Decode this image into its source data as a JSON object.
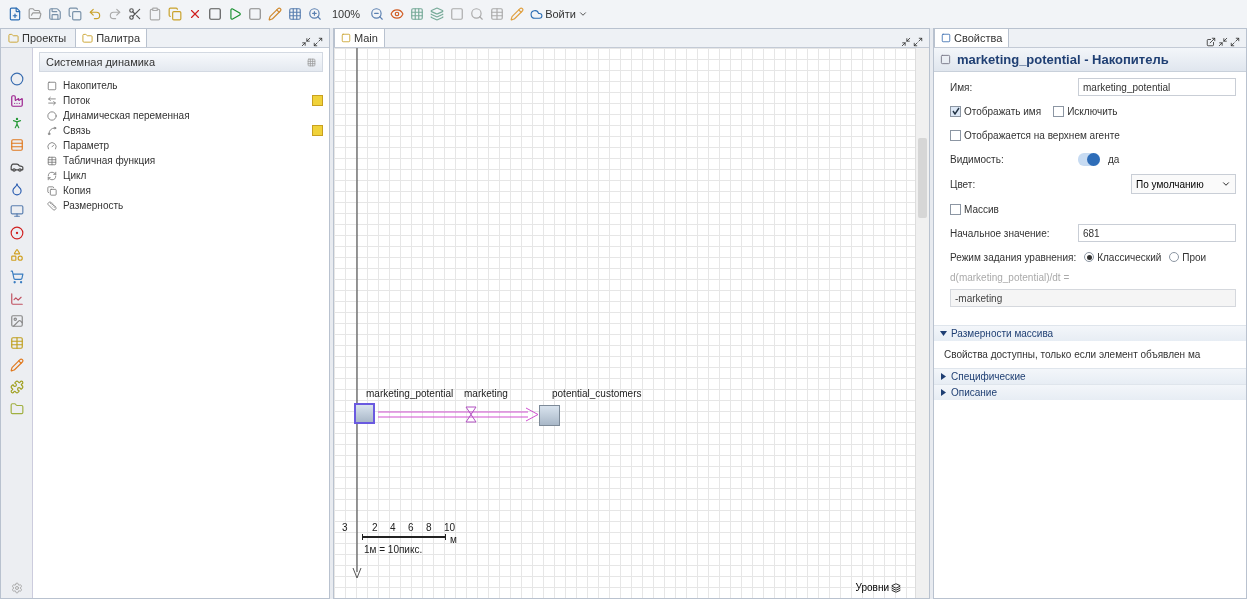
{
  "toolbar": {
    "zoom": "100%",
    "login_button": "Войти"
  },
  "left_panel": {
    "tabs": [
      {
        "label": "Проекты",
        "selected": false
      },
      {
        "label": "Палитра",
        "selected": true
      }
    ],
    "palette": {
      "title": "Системная динамика",
      "items": [
        {
          "label": "Накопитель",
          "kind": "stock",
          "shortcut": false
        },
        {
          "label": "Поток",
          "kind": "flow",
          "shortcut": true
        },
        {
          "label": "Динамическая переменная",
          "kind": "variable",
          "shortcut": false
        },
        {
          "label": "Связь",
          "kind": "link",
          "shortcut": true
        },
        {
          "label": "Параметр",
          "kind": "parameter",
          "shortcut": false
        },
        {
          "label": "Табличная функция",
          "kind": "table",
          "shortcut": false
        },
        {
          "label": "Цикл",
          "kind": "loop",
          "shortcut": false
        },
        {
          "label": "Копия",
          "kind": "copy",
          "shortcut": false
        },
        {
          "label": "Размерность",
          "kind": "dimension",
          "shortcut": false
        }
      ]
    }
  },
  "editor": {
    "tabs": [
      {
        "label": "Main",
        "selected": true
      }
    ],
    "diagram": {
      "stocks": [
        {
          "name": "marketing_potential",
          "selected": true
        },
        {
          "name": "potential_customers",
          "selected": false
        }
      ],
      "flow": {
        "name": "marketing"
      },
      "scale": {
        "origin": "3",
        "ticks": [
          "2",
          "4",
          "6",
          "8",
          "10"
        ],
        "unit": "м",
        "caption": "1м = 10пикс."
      },
      "layers_button": "Уровни"
    }
  },
  "properties": {
    "tabs": [
      {
        "label": "Свойства",
        "selected": true
      }
    ],
    "title": "marketing_potential - Накопитель",
    "fields": [
      {
        "kind": "text",
        "label": "Имя:",
        "value": "marketing_potential"
      },
      {
        "kind": "checks",
        "items": [
          {
            "label": "Отображать имя",
            "checked": true
          },
          {
            "label": "Исключить",
            "checked": false
          }
        ]
      },
      {
        "kind": "checks",
        "items": [
          {
            "label": "Отображается на верхнем агенте",
            "checked": false
          }
        ]
      },
      {
        "kind": "toggle",
        "label": "Видимость:",
        "on": true,
        "value": "да"
      },
      {
        "kind": "dropdown",
        "label": "Цвет:",
        "value": "По умолчанию"
      },
      {
        "kind": "checks",
        "items": [
          {
            "label": "Массив",
            "checked": false
          }
        ]
      },
      {
        "kind": "text",
        "label": "Начальное значение:",
        "value": "681"
      },
      {
        "kind": "radios",
        "label": "Режим задания уравнения:",
        "options": [
          {
            "label": "Классический",
            "selected": true
          },
          {
            "label": "Прои",
            "selected": false
          }
        ]
      },
      {
        "kind": "equation",
        "label": "d(marketing_potential)/dt =",
        "value": "-marketing"
      }
    ],
    "sections": [
      {
        "title": "Размерности массива",
        "expanded": true,
        "text": "Свойства доступны, только если элемент объявлен ма"
      },
      {
        "title": "Специфические",
        "expanded": false
      },
      {
        "title": "Описание",
        "expanded": false
      }
    ]
  }
}
